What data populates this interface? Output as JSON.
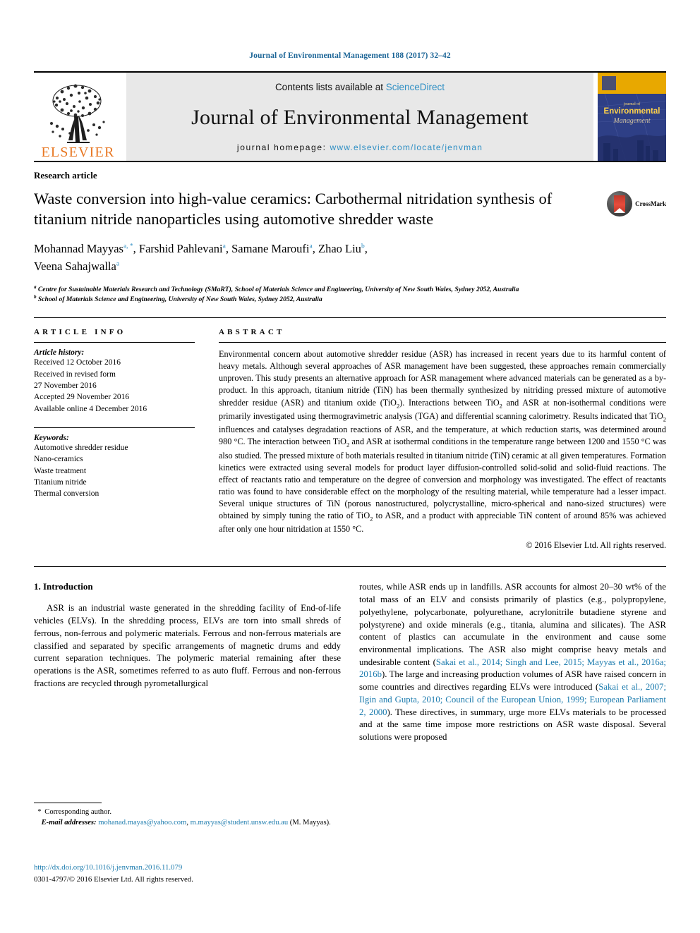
{
  "running_head": "Journal of Environmental Management 188 (2017) 32–42",
  "masthead": {
    "publisher_name": "ELSEVIER",
    "contents_prefix": "Contents lists available at ",
    "contents_link": "ScienceDirect",
    "journal_title": "Journal of Environmental Management",
    "homepage_prefix": "journal homepage: ",
    "homepage_url": "www.elsevier.com/locate/jenvman",
    "cover": {
      "line1": "journal of",
      "line2": "Environmental",
      "line3": "Management"
    }
  },
  "article": {
    "type": "Research article",
    "title": "Waste conversion into high-value ceramics: Carbothermal nitridation synthesis of titanium nitride nanoparticles using automotive shredder waste",
    "crossmark_label": "CrossMark",
    "authors_line1": "Mohannad Mayyas",
    "authors": [
      {
        "name": "Mohannad Mayyas",
        "sup": "a, *"
      },
      {
        "name": "Farshid Pahlevani",
        "sup": "a"
      },
      {
        "name": "Samane Maroufi",
        "sup": "a"
      },
      {
        "name": "Zhao Liu",
        "sup": "b"
      },
      {
        "name": "Veena Sahajwalla",
        "sup": "a"
      }
    ],
    "affiliations": [
      {
        "sup": "a",
        "text": "Centre for Sustainable Materials Research and Technology (SMaRT), School of Materials Science and Engineering, University of New South Wales, Sydney 2052, Australia"
      },
      {
        "sup": "b",
        "text": "School of Materials Science and Engineering, University of New South Wales, Sydney 2052, Australia"
      }
    ]
  },
  "article_info": {
    "heading": "ARTICLE INFO",
    "history_label": "Article history:",
    "history": [
      "Received 12 October 2016",
      "Received in revised form",
      "27 November 2016",
      "Accepted 29 November 2016",
      "Available online 4 December 2016"
    ],
    "keywords_label": "Keywords:",
    "keywords": [
      "Automotive shredder residue",
      "Nano-ceramics",
      "Waste treatment",
      "Titanium nitride",
      "Thermal conversion"
    ]
  },
  "abstract": {
    "heading": "ABSTRACT",
    "p1_a": "Environmental concern about automotive shredder residue (ASR) has increased in recent years due to its harmful content of heavy metals. Although several approaches of ASR management have been suggested, these approaches remain commercially unproven. This study presents an alternative approach for ASR management where advanced materials can be generated as a by-product. In this approach, titanium nitride (TiN) has been thermally synthesized by nitriding pressed mixture of automotive shredder residue (ASR) and titanium oxide (TiO",
    "p1_b": "). Interactions between TiO",
    "p1_c": " and ASR at non-isothermal conditions were primarily investigated using thermogravimetric analysis (TGA) and differential scanning calorimetry. Results indicated that TiO",
    "p1_d": " influences and catalyses degradation reactions of ASR, and the temperature, at which reduction starts, was determined around 980 °C. The interaction between TiO",
    "p1_e": " and ASR at isothermal conditions in the temperature range between 1200 and 1550 °C was also studied. The pressed mixture of both materials resulted in titanium nitride (TiN) ceramic at all given temperatures. Formation kinetics were extracted using several models for product layer diffusion-controlled solid-solid and solid-fluid reactions. The effect of reactants ratio and temperature on the degree of conversion and morphology was investigated. The effect of reactants ratio was found to have considerable effect on the morphology of the resulting material, while temperature had a lesser impact. Several unique structures of TiN (porous nanostructured, polycrystalline, micro-spherical and nano-sized structures) were obtained by simply tuning the ratio of TiO",
    "p1_f": " to ASR, and a product with appreciable TiN content of around 85% was achieved after only one hour nitridation at 1550 °C.",
    "subscript": "2",
    "copyright": "© 2016 Elsevier Ltd. All rights reserved."
  },
  "body": {
    "section_number_title": "1. Introduction",
    "left_paragraph": "ASR is an industrial waste generated in the shredding facility of End-of-life vehicles (ELVs). In the shredding process, ELVs are torn into small shreds of ferrous, non-ferrous and polymeric materials. Ferrous and non-ferrous materials are classified and separated by specific arrangements of magnetic drums and eddy current separation techniques. The polymeric material remaining after these operations is the ASR, sometimes referred to as auto fluff. Ferrous and non-ferrous fractions are recycled through pyrometallurgical",
    "right_part1": "routes, while ASR ends up in landfills. ASR accounts for almost 20–30 wt% of the total mass of an ELV and consists primarily of plastics (e.g., polypropylene, polyethylene, polycarbonate, polyurethane, acrylonitrile butadiene styrene and polystyrene) and oxide minerals (e.g., titania, alumina and silicates). The ASR content of plastics can accumulate in the environment and cause some environmental implications. The ASR also might comprise heavy metals and undesirable content (",
    "right_cite1": "Sakai et al., 2014; Singh and Lee, 2015; Mayyas et al., 2016a; 2016b",
    "right_part2": "). The large and increasing production volumes of ASR have raised concern in some countries and directives regarding ELVs were introduced (",
    "right_cite2": "Sakai et al., 2007; Ilgin and Gupta, 2010; Council of the European Union, 1999; European Parliament 2, 2000",
    "right_part3": "). These directives, in summary, urge more ELVs materials to be processed and at the same time impose more restrictions on ASR waste disposal. Several solutions were proposed"
  },
  "footnote": {
    "star": "*",
    "corresponding": "Corresponding author.",
    "email_label": "E-mail addresses:",
    "email1": "mohanad.mayas@yahoo.com",
    "email_sep": ", ",
    "email2": "m.mayyas@student.unsw.edu.au",
    "email_suffix": " (M. Mayyas)."
  },
  "doi_block": {
    "doi": "http://dx.doi.org/10.1016/j.jenvman.2016.11.079",
    "issn_line": "0301-4797/© 2016 Elsevier Ltd. All rights reserved."
  },
  "colors": {
    "link_blue": "#1a7aad",
    "header_blue": "#1a6496",
    "sciencedirect_blue": "#2f8fc4",
    "elsevier_orange": "#e87722",
    "masthead_grey": "#e8e8e8",
    "cover_blue": "#2e3f86",
    "cover_gold": "#e8a800"
  }
}
